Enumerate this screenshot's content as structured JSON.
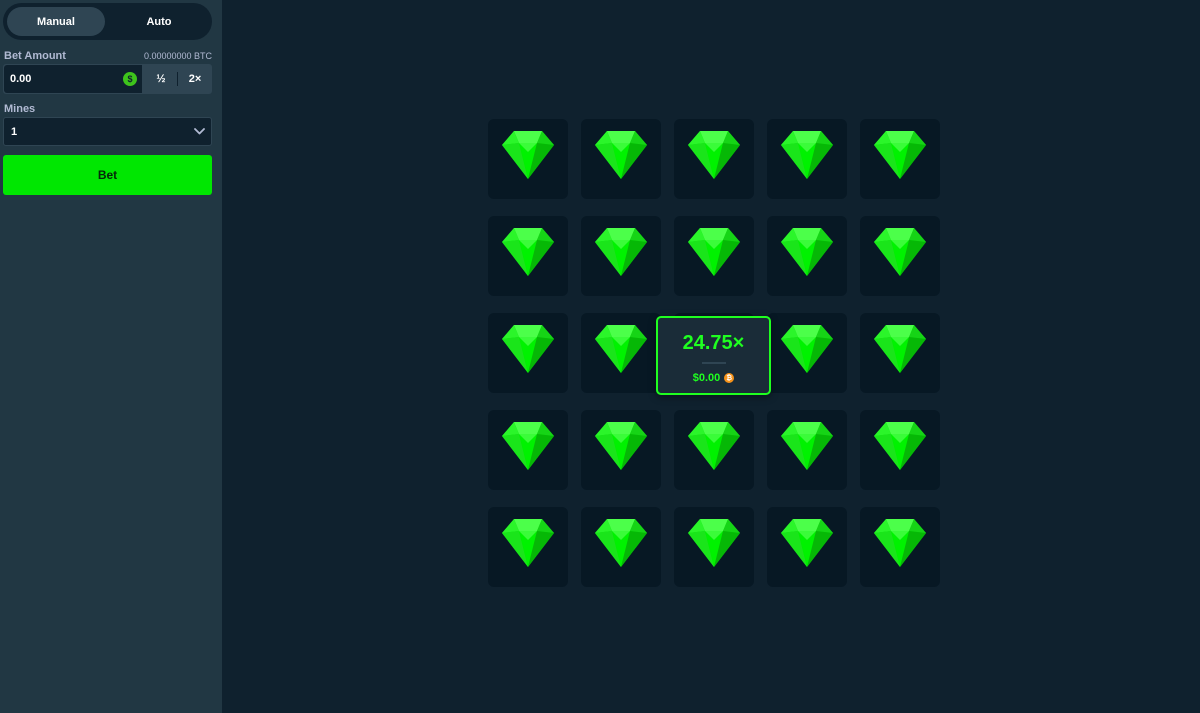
{
  "sidebar": {
    "tabs": [
      {
        "label": "Manual",
        "active": true
      },
      {
        "label": "Auto",
        "active": false
      }
    ],
    "bet_amount": {
      "label": "Bet Amount",
      "balance": "0.00000000 BTC",
      "value": "0.00",
      "currency_icon": "dollar-coin-icon",
      "half_label": "½",
      "double_label": "2×"
    },
    "mines": {
      "label": "Mines",
      "selected": "1"
    },
    "bet_button_label": "Bet"
  },
  "board": {
    "rows": 5,
    "cols": 5,
    "tile_icon": "green-gem-icon",
    "win_popup": {
      "multiplier": "24.75×",
      "payout": "$0.00",
      "currency_icon": "btc-coin-icon"
    }
  },
  "colors": {
    "background": "#0f212e",
    "sidebar": "#213743",
    "tile": "#071824",
    "accent_green": "#00e701",
    "win_green": "#1fff20"
  }
}
